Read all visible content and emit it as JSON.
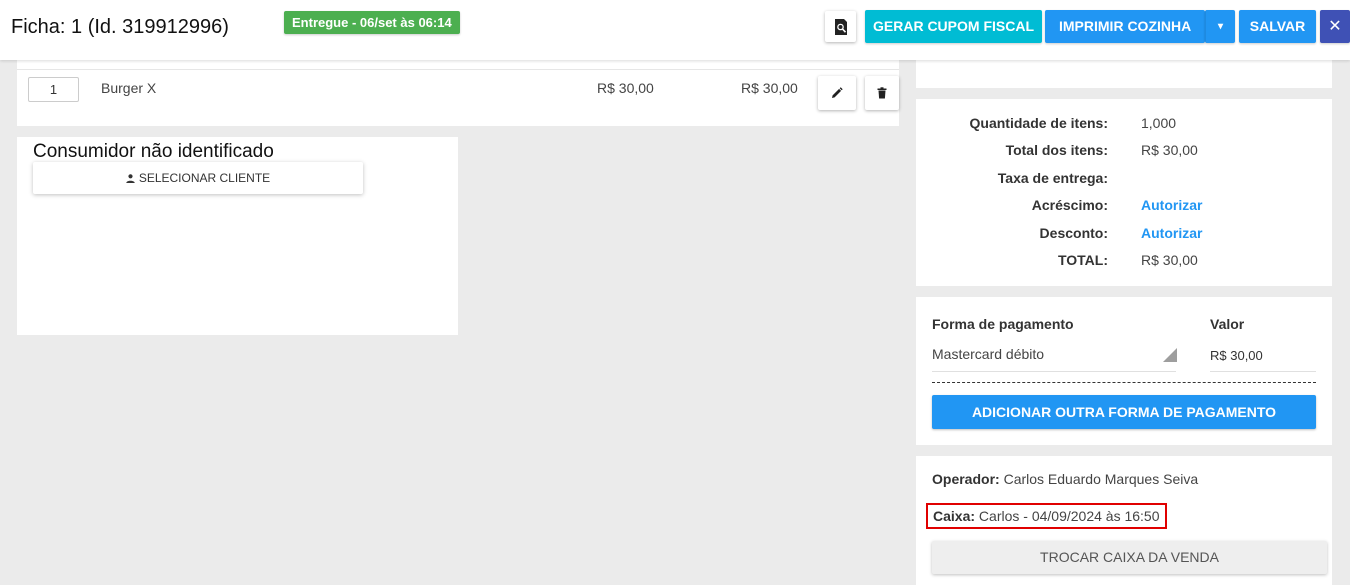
{
  "header": {
    "title": "Ficha: 1 (Id. 319912996)",
    "status_badge": "Entregue - 06/set às 06:14",
    "preview_icon": "search-document-icon",
    "cupom_label": "GERAR CUPOM FISCAL",
    "cozinha_label": "IMPRIMIR COZINHA",
    "cozinha_caret": "▾",
    "salvar_label": "SALVAR",
    "close_glyph": "✕",
    "colors": {
      "badge": "#4caf50",
      "cupom": "#00bcd4",
      "primary": "#2196f3",
      "close": "#3f51b5"
    }
  },
  "items": [
    {
      "qty": "1",
      "name": "Burger X",
      "unit_price": "R$ 30,00",
      "total": "R$ 30,00",
      "edit_icon": "pencil-icon",
      "delete_icon": "trash-icon"
    }
  ],
  "customer": {
    "name": "Consumidor não identificado",
    "select_label": "SELECIONAR CLIENTE",
    "select_icon": "person-icon"
  },
  "totals": {
    "rows": [
      {
        "label": "Quantidade de itens:",
        "value": "1,000",
        "type": "text"
      },
      {
        "label": "Total dos itens:",
        "value": "R$ 30,00",
        "type": "text"
      },
      {
        "label": "Taxa de entrega:",
        "value": "",
        "type": "text"
      },
      {
        "label": "Acréscimo:",
        "value": "Autorizar",
        "type": "link"
      },
      {
        "label": "Desconto:",
        "value": "Autorizar",
        "type": "link"
      },
      {
        "label": "TOTAL:",
        "value": "R$ 30,00",
        "type": "text"
      }
    ]
  },
  "payment": {
    "method_header": "Forma de pagamento",
    "value_header": "Valor",
    "method": "Mastercard débito",
    "value": "R$ 30,00",
    "add_label": "ADICIONAR OUTRA FORMA DE PAGAMENTO"
  },
  "operator": {
    "operator_label": "Operador:",
    "operator_name": "Carlos Eduardo Marques Seiva",
    "caixa_label": "Caixa:",
    "caixa_value": "Carlos - 04/09/2024 às 16:50",
    "trocar_label": "TROCAR CAIXA DA VENDA"
  }
}
